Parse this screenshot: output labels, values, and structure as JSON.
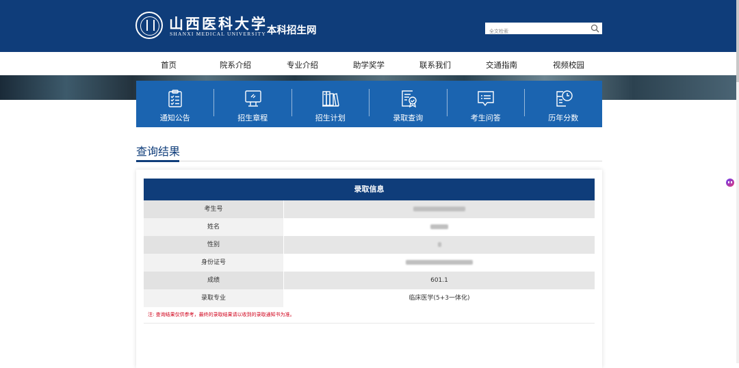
{
  "header": {
    "brand_cn": "山西医科大学",
    "brand_en": "SHANXI MEDICAL UNIVERSITY",
    "site_title": "本科招生网",
    "search_placeholder": "全文检索"
  },
  "nav": {
    "items": [
      {
        "label": "首页"
      },
      {
        "label": "院系介绍"
      },
      {
        "label": "专业介绍"
      },
      {
        "label": "助学奖学"
      },
      {
        "label": "联系我们"
      },
      {
        "label": "交通指南"
      },
      {
        "label": "视频校园"
      }
    ]
  },
  "quick_links": [
    {
      "label": "通知公告",
      "icon": "clipboard-list-icon"
    },
    {
      "label": "招生章程",
      "icon": "monitor-icon"
    },
    {
      "label": "招生计划",
      "icon": "books-icon"
    },
    {
      "label": "录取查询",
      "icon": "certificate-icon"
    },
    {
      "label": "考生问答",
      "icon": "chat-bubble-icon"
    },
    {
      "label": "历年分数",
      "icon": "calendar-clock-icon"
    }
  ],
  "section": {
    "title": "查询结果"
  },
  "result": {
    "header": "录取信息",
    "rows": [
      {
        "label": "考生号",
        "value": "",
        "redacted": true
      },
      {
        "label": "姓名",
        "value": "",
        "redacted": true
      },
      {
        "label": "性别",
        "value": "",
        "redacted": true
      },
      {
        "label": "身份证号",
        "value": "",
        "redacted": true
      },
      {
        "label": "成绩",
        "value": "601.1",
        "redacted": false
      },
      {
        "label": "录取专业",
        "value": "临床医学(5+3一体化)",
        "redacted": false
      }
    ],
    "note": "注: 查询结果仅供参考，最终的录取结果请以收到的录取通知书为准。"
  },
  "colors": {
    "header_bg": "#0f3d7a",
    "quick_bar_bg": "#1b64b0",
    "note_color": "#d0021b"
  }
}
